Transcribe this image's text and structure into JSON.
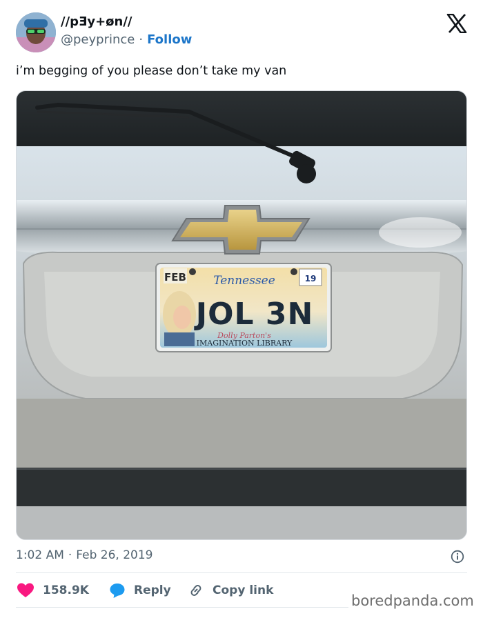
{
  "tweet": {
    "display_name": "//pƎy+øn//",
    "handle": "@peyprince",
    "separator": "·",
    "follow_label": "Follow",
    "text": "i’m begging of you please don’t take my van",
    "time": "1:02 AM",
    "date": "Feb 26, 2019",
    "x_logo": "x-logo-icon"
  },
  "photo": {
    "plate": {
      "month": "FEB",
      "year": "19",
      "state": "Tennessee",
      "number": "JOL 3N",
      "sponsor_line": "Dolly Parton's",
      "sponsor_name": "IMAGINATION LIBRARY"
    }
  },
  "actions": {
    "likes": "158.9K",
    "reply_label": "Reply",
    "copy_label": "Copy link"
  },
  "watermark": "boredpanda.com",
  "colors": {
    "like": "#f91880",
    "reply": "#1d9bf0",
    "follow": "#1d76c9",
    "muted": "#536471"
  }
}
